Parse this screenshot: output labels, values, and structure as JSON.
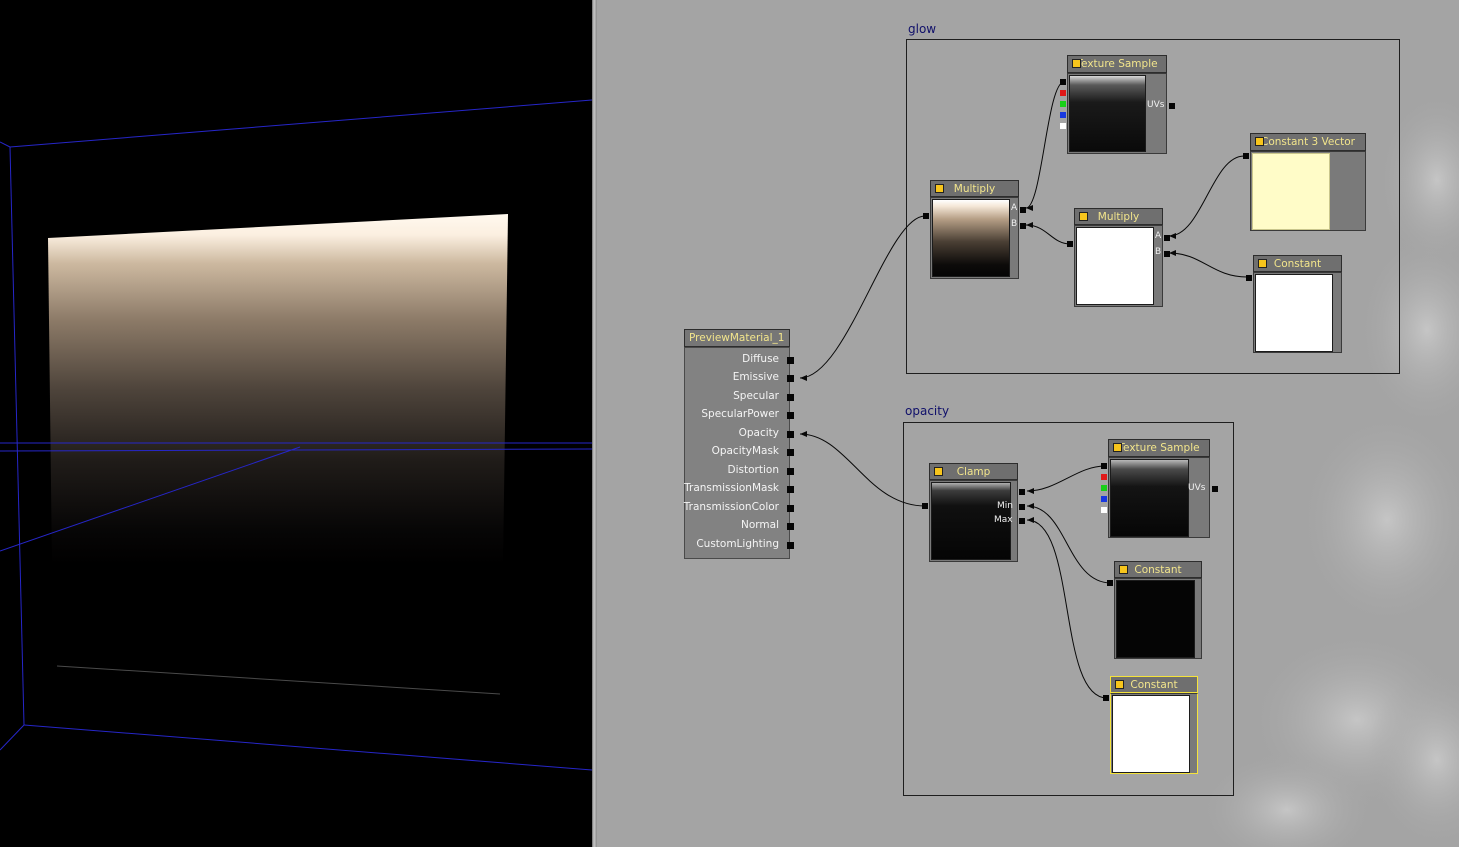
{
  "preview_viewport": {
    "wireframe_color": "#2626c8"
  },
  "material": {
    "name": "PreviewMaterial_1",
    "inputs": [
      "Diffuse",
      "Emissive",
      "Specular",
      "SpecularPower",
      "Opacity",
      "OpacityMask",
      "Distortion",
      "TransmissionMask",
      "TransmissionColor",
      "Normal",
      "CustomLighting"
    ]
  },
  "comments": {
    "glow": "glow",
    "opacity": "opacity"
  },
  "nodes": {
    "glow_texture": {
      "title": "Texture Sample",
      "uv_label": "UVs"
    },
    "glow_multiply1": {
      "title": "Multiply",
      "in_a": "A",
      "in_b": "B"
    },
    "glow_multiply2": {
      "title": "Multiply",
      "in_a": "A",
      "in_b": "B"
    },
    "glow_const3vec": {
      "title": "Constant 3 Vector",
      "color": "#fffcc8"
    },
    "glow_constant": {
      "title": "Constant"
    },
    "opacity_clamp": {
      "title": "Clamp",
      "in_min": "Min",
      "in_max": "Max"
    },
    "opacity_texture": {
      "title": "Texture Sample",
      "uv_label": "UVs"
    },
    "opacity_constant_black": {
      "title": "Constant"
    },
    "opacity_constant_white": {
      "title": "Constant"
    }
  },
  "colors": {
    "node_title_text": "#f2e58c",
    "comment_title_text": "#10106a",
    "canvas_background": "#a4a4a4",
    "selected_outline": "#f5e33a",
    "channel_red": "#e01818",
    "channel_green": "#18d018",
    "channel_blue": "#1838e0",
    "channel_alpha": "#ffffff"
  }
}
